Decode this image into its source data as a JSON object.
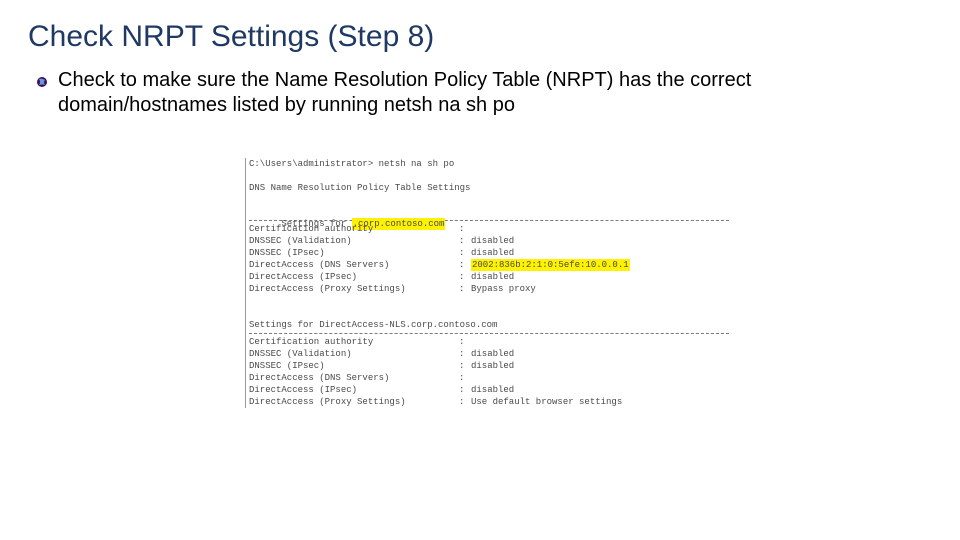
{
  "title": "Check NRPT Settings (Step 8)",
  "bullet": "Check to make sure the Name Resolution Policy Table (NRPT) has the correct domain/hostnames listed by running netsh na sh po",
  "terminal": {
    "prompt": "C:\\Users\\administrator> netsh na sh po",
    "heading": "DNS Name Resolution Policy Table Settings",
    "block1": {
      "settings_for_prefix": "Settings for ",
      "settings_for_value": ".corp.contoso.com",
      "rows": [
        {
          "label": "Certification authority",
          "value": ""
        },
        {
          "label": "DNSSEC (Validation)",
          "value": "disabled"
        },
        {
          "label": "DNSSEC (IPsec)",
          "value": "disabled"
        },
        {
          "label": "DirectAccess (DNS Servers)",
          "value": "2002:836b:2:1:0:5efe:10.0.0.1",
          "highlight": true
        },
        {
          "label": "DirectAccess (IPsec)",
          "value": "disabled"
        },
        {
          "label": "DirectAccess (Proxy Settings)",
          "value": "Bypass proxy"
        }
      ]
    },
    "block2": {
      "settings_for": "Settings for DirectAccess-NLS.corp.contoso.com",
      "rows": [
        {
          "label": "Certification authority",
          "value": ""
        },
        {
          "label": "DNSSEC (Validation)",
          "value": "disabled"
        },
        {
          "label": "DNSSEC (IPsec)",
          "value": "disabled"
        },
        {
          "label": "DirectAccess (DNS Servers)",
          "value": ""
        },
        {
          "label": "DirectAccess (IPsec)",
          "value": "disabled"
        },
        {
          "label": "DirectAccess (Proxy Settings)",
          "value": "Use default browser settings"
        }
      ]
    }
  }
}
